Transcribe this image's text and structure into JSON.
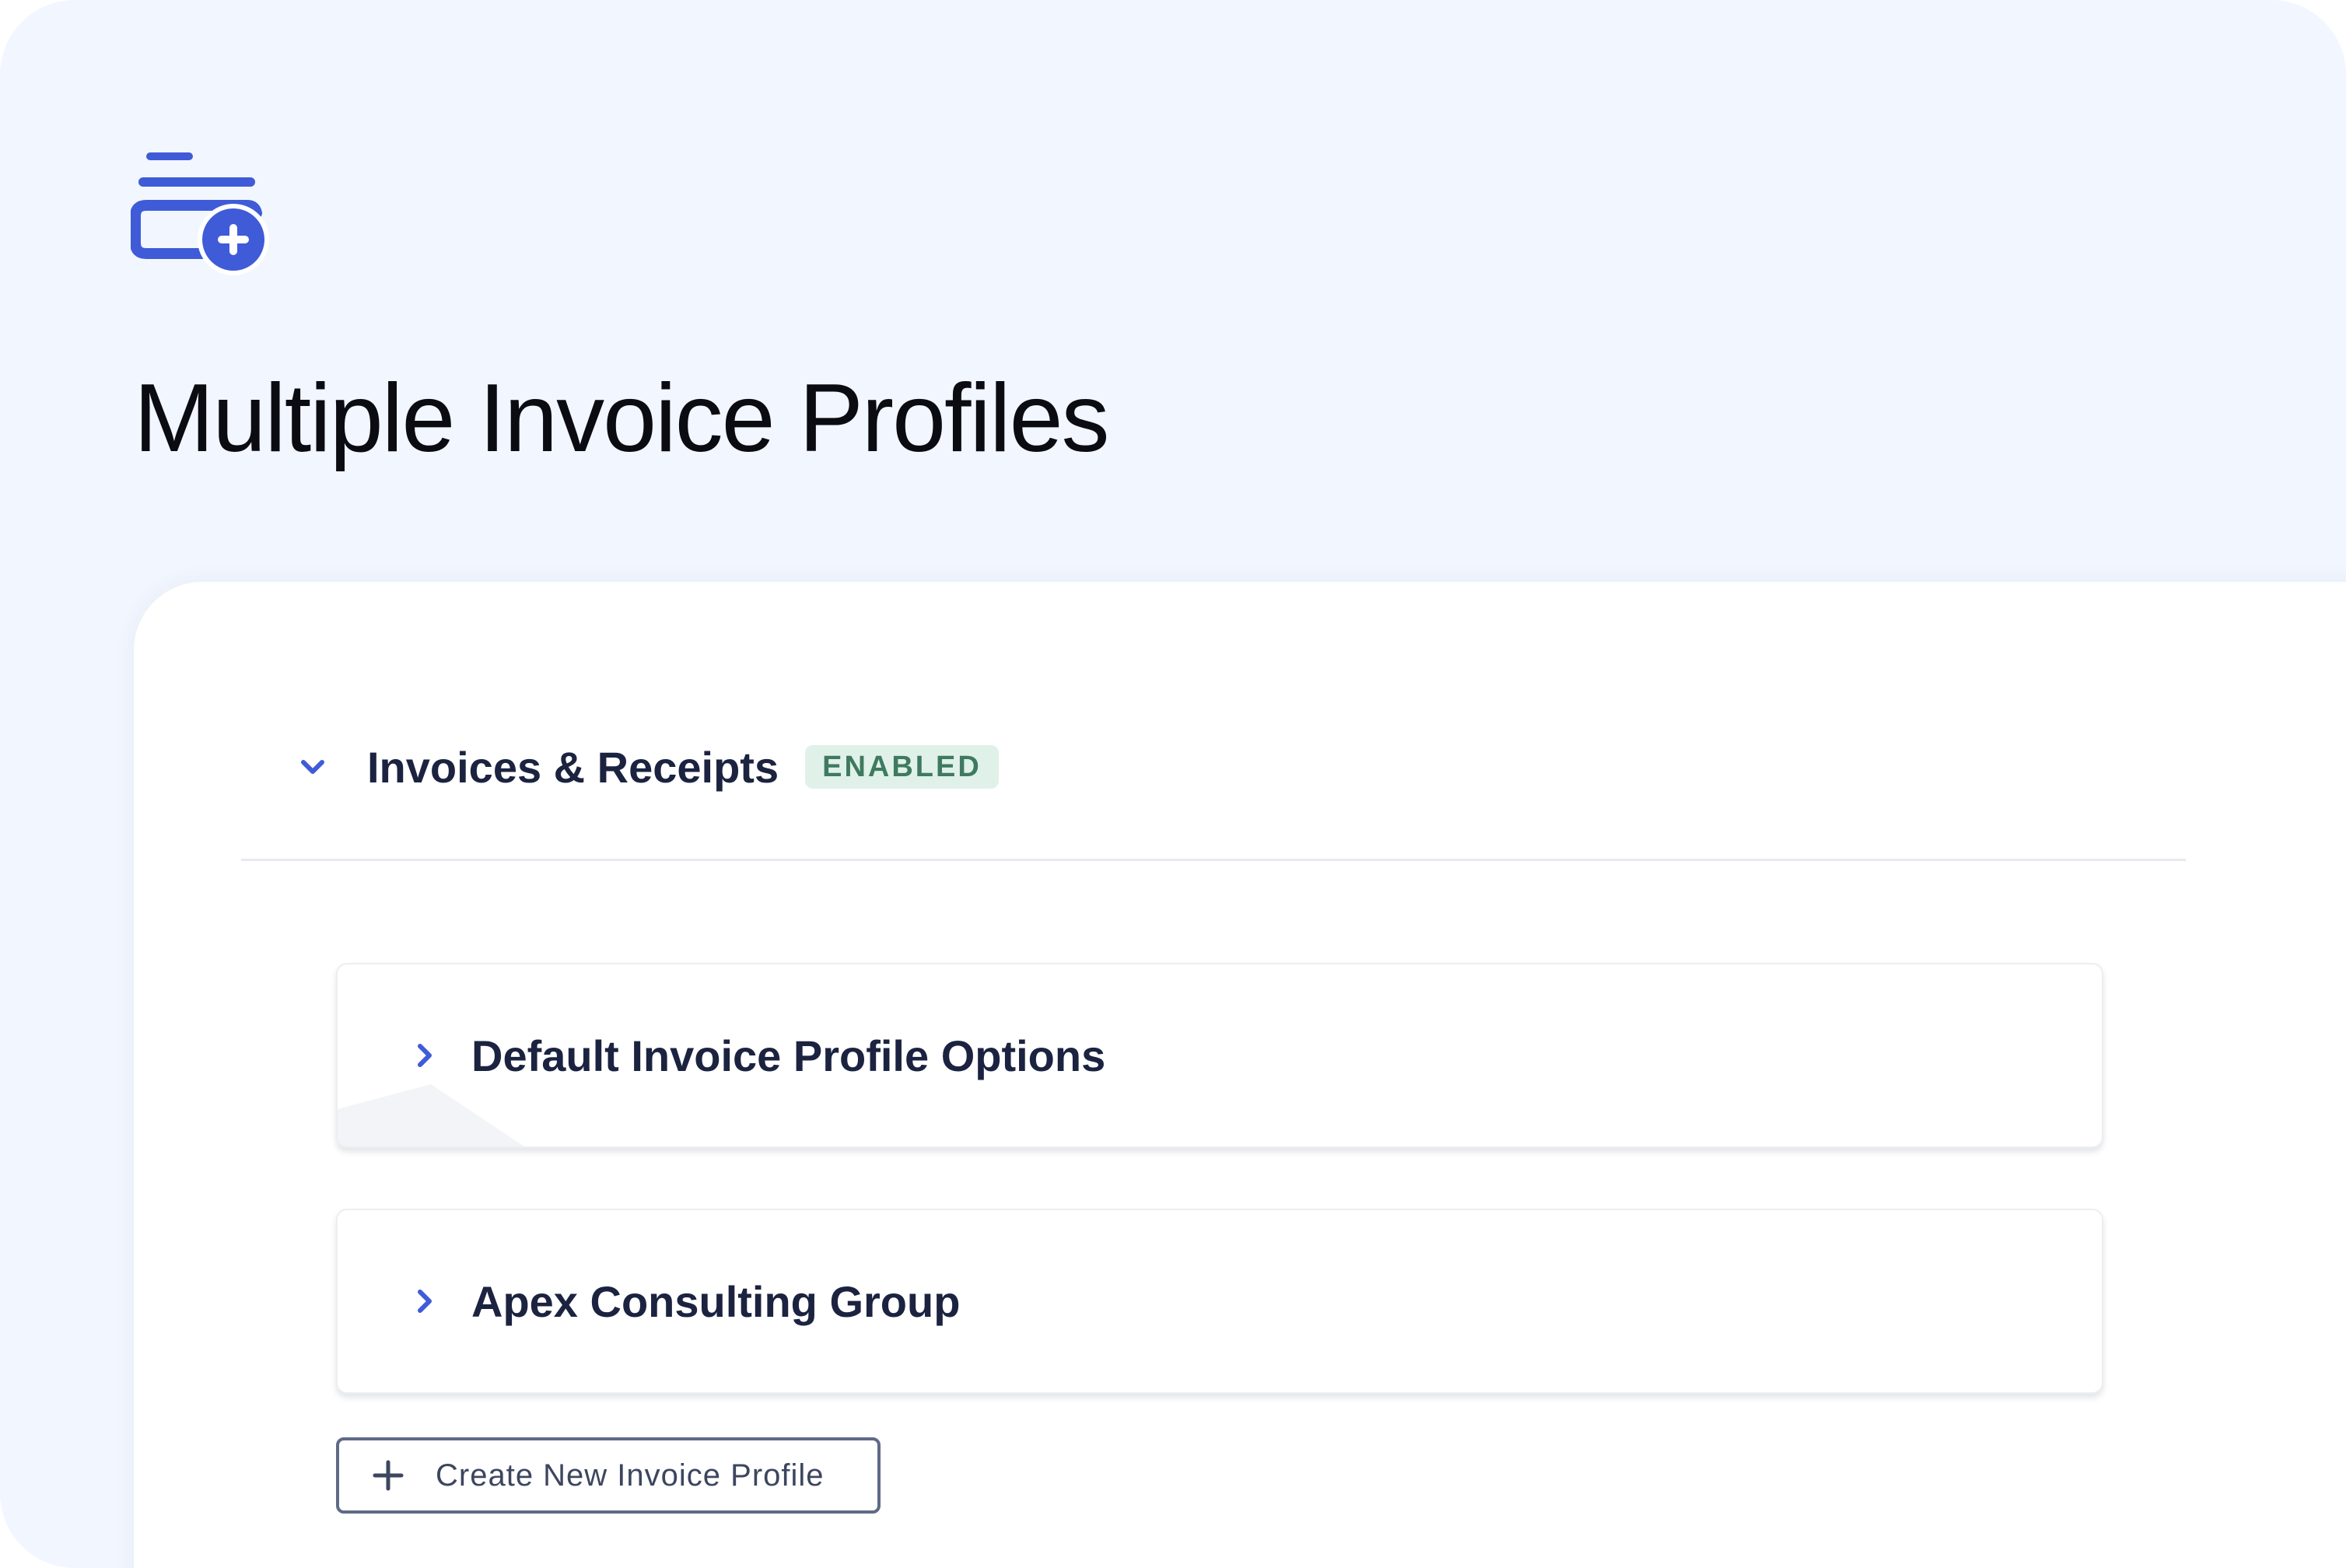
{
  "page": {
    "title": "Multiple Invoice Profiles",
    "hero_icon": "invoice-list-add-icon"
  },
  "section": {
    "title": "Invoices & Receipts",
    "status_badge": "ENABLED",
    "expanded": true,
    "chevron_icon": "chevron-down-icon"
  },
  "profiles": [
    {
      "title": "Default Invoice Profile Options",
      "chevron_icon": "chevron-right-icon",
      "expanded": false
    },
    {
      "title": "Apex Consulting Group",
      "chevron_icon": "chevron-right-icon",
      "expanded": false
    }
  ],
  "create_button": {
    "label": "Create New Invoice Profile",
    "icon": "plus-icon"
  },
  "colors": {
    "background": "#f2f6fe",
    "accent": "#3f5bd8",
    "badge_bg": "#e0f1ea",
    "badge_text": "#3e7a5f",
    "heading_text": "#1b2340"
  }
}
